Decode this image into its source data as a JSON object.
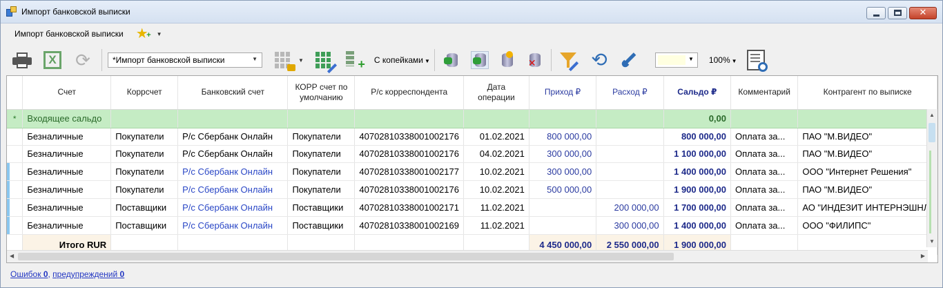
{
  "window": {
    "title": "Импорт банковской выписки"
  },
  "menu": {
    "item": "Импорт банковской выписки"
  },
  "toolbar": {
    "combo_value": "*Импорт банковской выписки",
    "kopecks_label": "С копейками",
    "zoom": "100%",
    "color_swatch": "#ffffe0"
  },
  "grid": {
    "columns": [
      {
        "label": "Счет"
      },
      {
        "label": "Коррсчет"
      },
      {
        "label": "Банковский счет"
      },
      {
        "label": "КОРР счет по умолчанию"
      },
      {
        "label": "Р/с корреспондента"
      },
      {
        "label": "Дата операции"
      },
      {
        "label": "Приход ₽"
      },
      {
        "label": "Расход ₽"
      },
      {
        "label": "Сальдо ₽"
      },
      {
        "label": "Комментарий"
      },
      {
        "label": "Контрагент по выписке"
      }
    ],
    "incoming_balance": {
      "marker": "*",
      "label": "Входящее сальдо",
      "saldo": "0,00"
    },
    "rows": [
      {
        "schet": "Безналичные",
        "korr": "Покупатели",
        "bank": "Р/с Сбербанк Онлайн",
        "korr_default": "Покупатели",
        "rs": "40702810338001002176",
        "date": "01.02.2021",
        "prihod": "800 000,00",
        "rashod": "",
        "saldo": "800 000,00",
        "comment": "Оплата за...",
        "kontragent": "ПАО \"М.ВИДЕО\""
      },
      {
        "schet": "Безналичные",
        "korr": "Покупатели",
        "bank": "Р/с Сбербанк Онлайн",
        "korr_default": "Покупатели",
        "rs": "40702810338001002176",
        "date": "04.02.2021",
        "prihod": "300 000,00",
        "rashod": "",
        "saldo": "1 100 000,00",
        "comment": "Оплата за...",
        "kontragent": "ПАО \"М.ВИДЕО\""
      },
      {
        "schet": "Безналичные",
        "korr": "Покупатели",
        "bank": "Р/с Сбербанк Онлайн",
        "korr_default": "Покупатели",
        "rs": "40702810338001002177",
        "date": "10.02.2021",
        "prihod": "300 000,00",
        "rashod": "",
        "saldo": "1 400 000,00",
        "comment": "Оплата за...",
        "kontragent": "ООО \"Интернет Решения\""
      },
      {
        "schet": "Безналичные",
        "korr": "Покупатели",
        "bank": "Р/с Сбербанк Онлайн",
        "korr_default": "Покупатели",
        "rs": "40702810338001002176",
        "date": "10.02.2021",
        "prihod": "500 000,00",
        "rashod": "",
        "saldo": "1 900 000,00",
        "comment": "Оплата за...",
        "kontragent": "ПАО \"М.ВИДЕО\""
      },
      {
        "schet": "Безналичные",
        "korr": "Поставщики",
        "bank": "Р/с Сбербанк Онлайн",
        "korr_default": "Поставщики",
        "rs": "40702810338001002171",
        "date": "11.02.2021",
        "prihod": "",
        "rashod": "200 000,00",
        "saldo": "1 700 000,00",
        "comment": "Оплата за...",
        "kontragent": "АО \"ИНДЕЗИТ ИНТЕРНЭШНЛ\""
      },
      {
        "schet": "Безналичные",
        "korr": "Поставщики",
        "bank": "Р/с Сбербанк Онлайн",
        "korr_default": "Поставщики",
        "rs": "40702810338001002169",
        "date": "11.02.2021",
        "prihod": "",
        "rashod": "300 000,00",
        "saldo": "1 400 000,00",
        "comment": "Оплата за...",
        "kontragent": "ООО \"ФИЛИПС\""
      }
    ],
    "totals": {
      "label": "Итого RUR",
      "prihod": "4 450 000,00",
      "rashod": "2 550 000,00",
      "saldo": "1 900 000,00"
    }
  },
  "status": {
    "errors_label": "Ошибок",
    "errors_count": "0",
    "warnings_label": "предупреждений",
    "warnings_count": "0"
  }
}
